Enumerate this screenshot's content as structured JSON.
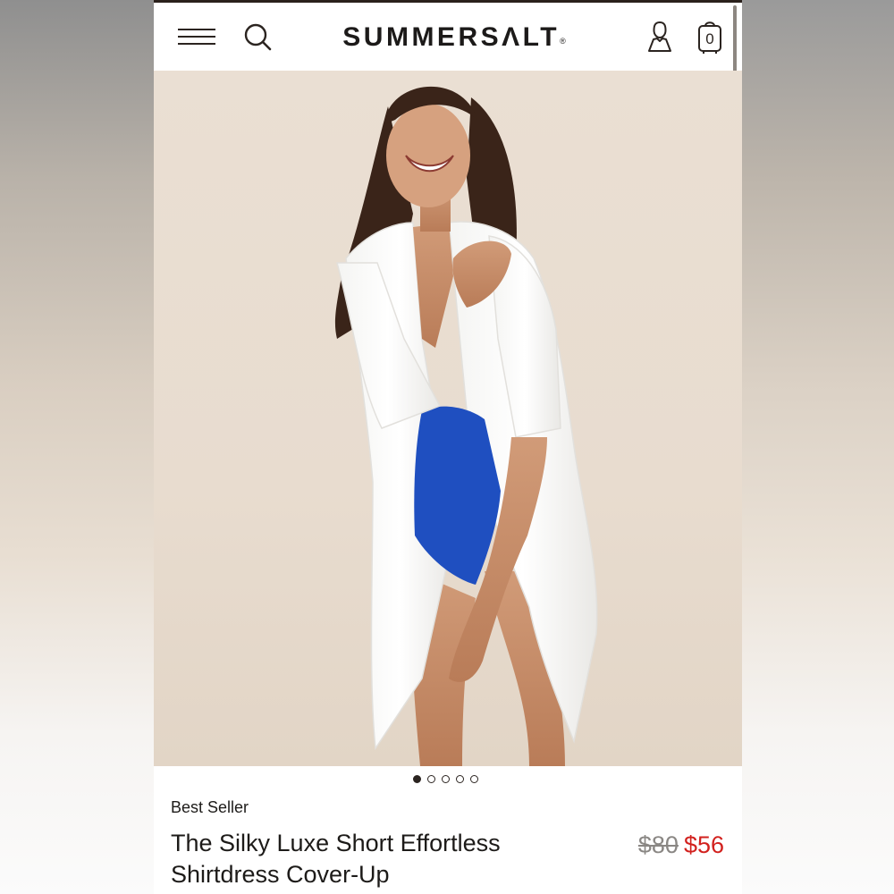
{
  "header": {
    "brand": "SUMMERSΛLT",
    "brand_mark": "®",
    "cart_count": "0"
  },
  "icons": [
    "menu-icon",
    "search-icon",
    "account-icon",
    "cart-icon"
  ],
  "carousel": {
    "total_slides": 5,
    "active_slide": 1
  },
  "product": {
    "badge": "Best Seller",
    "title": "The Silky Luxe Short Effortless Shirtdress Cover-Up",
    "original_price": "$80",
    "sale_price": "$56"
  },
  "colors": {
    "sale_price": "#d2211e",
    "brand_text": "#1c1a19",
    "hero_background": "#eadfd3",
    "swimsuit_blue": "#1f4fc0"
  }
}
